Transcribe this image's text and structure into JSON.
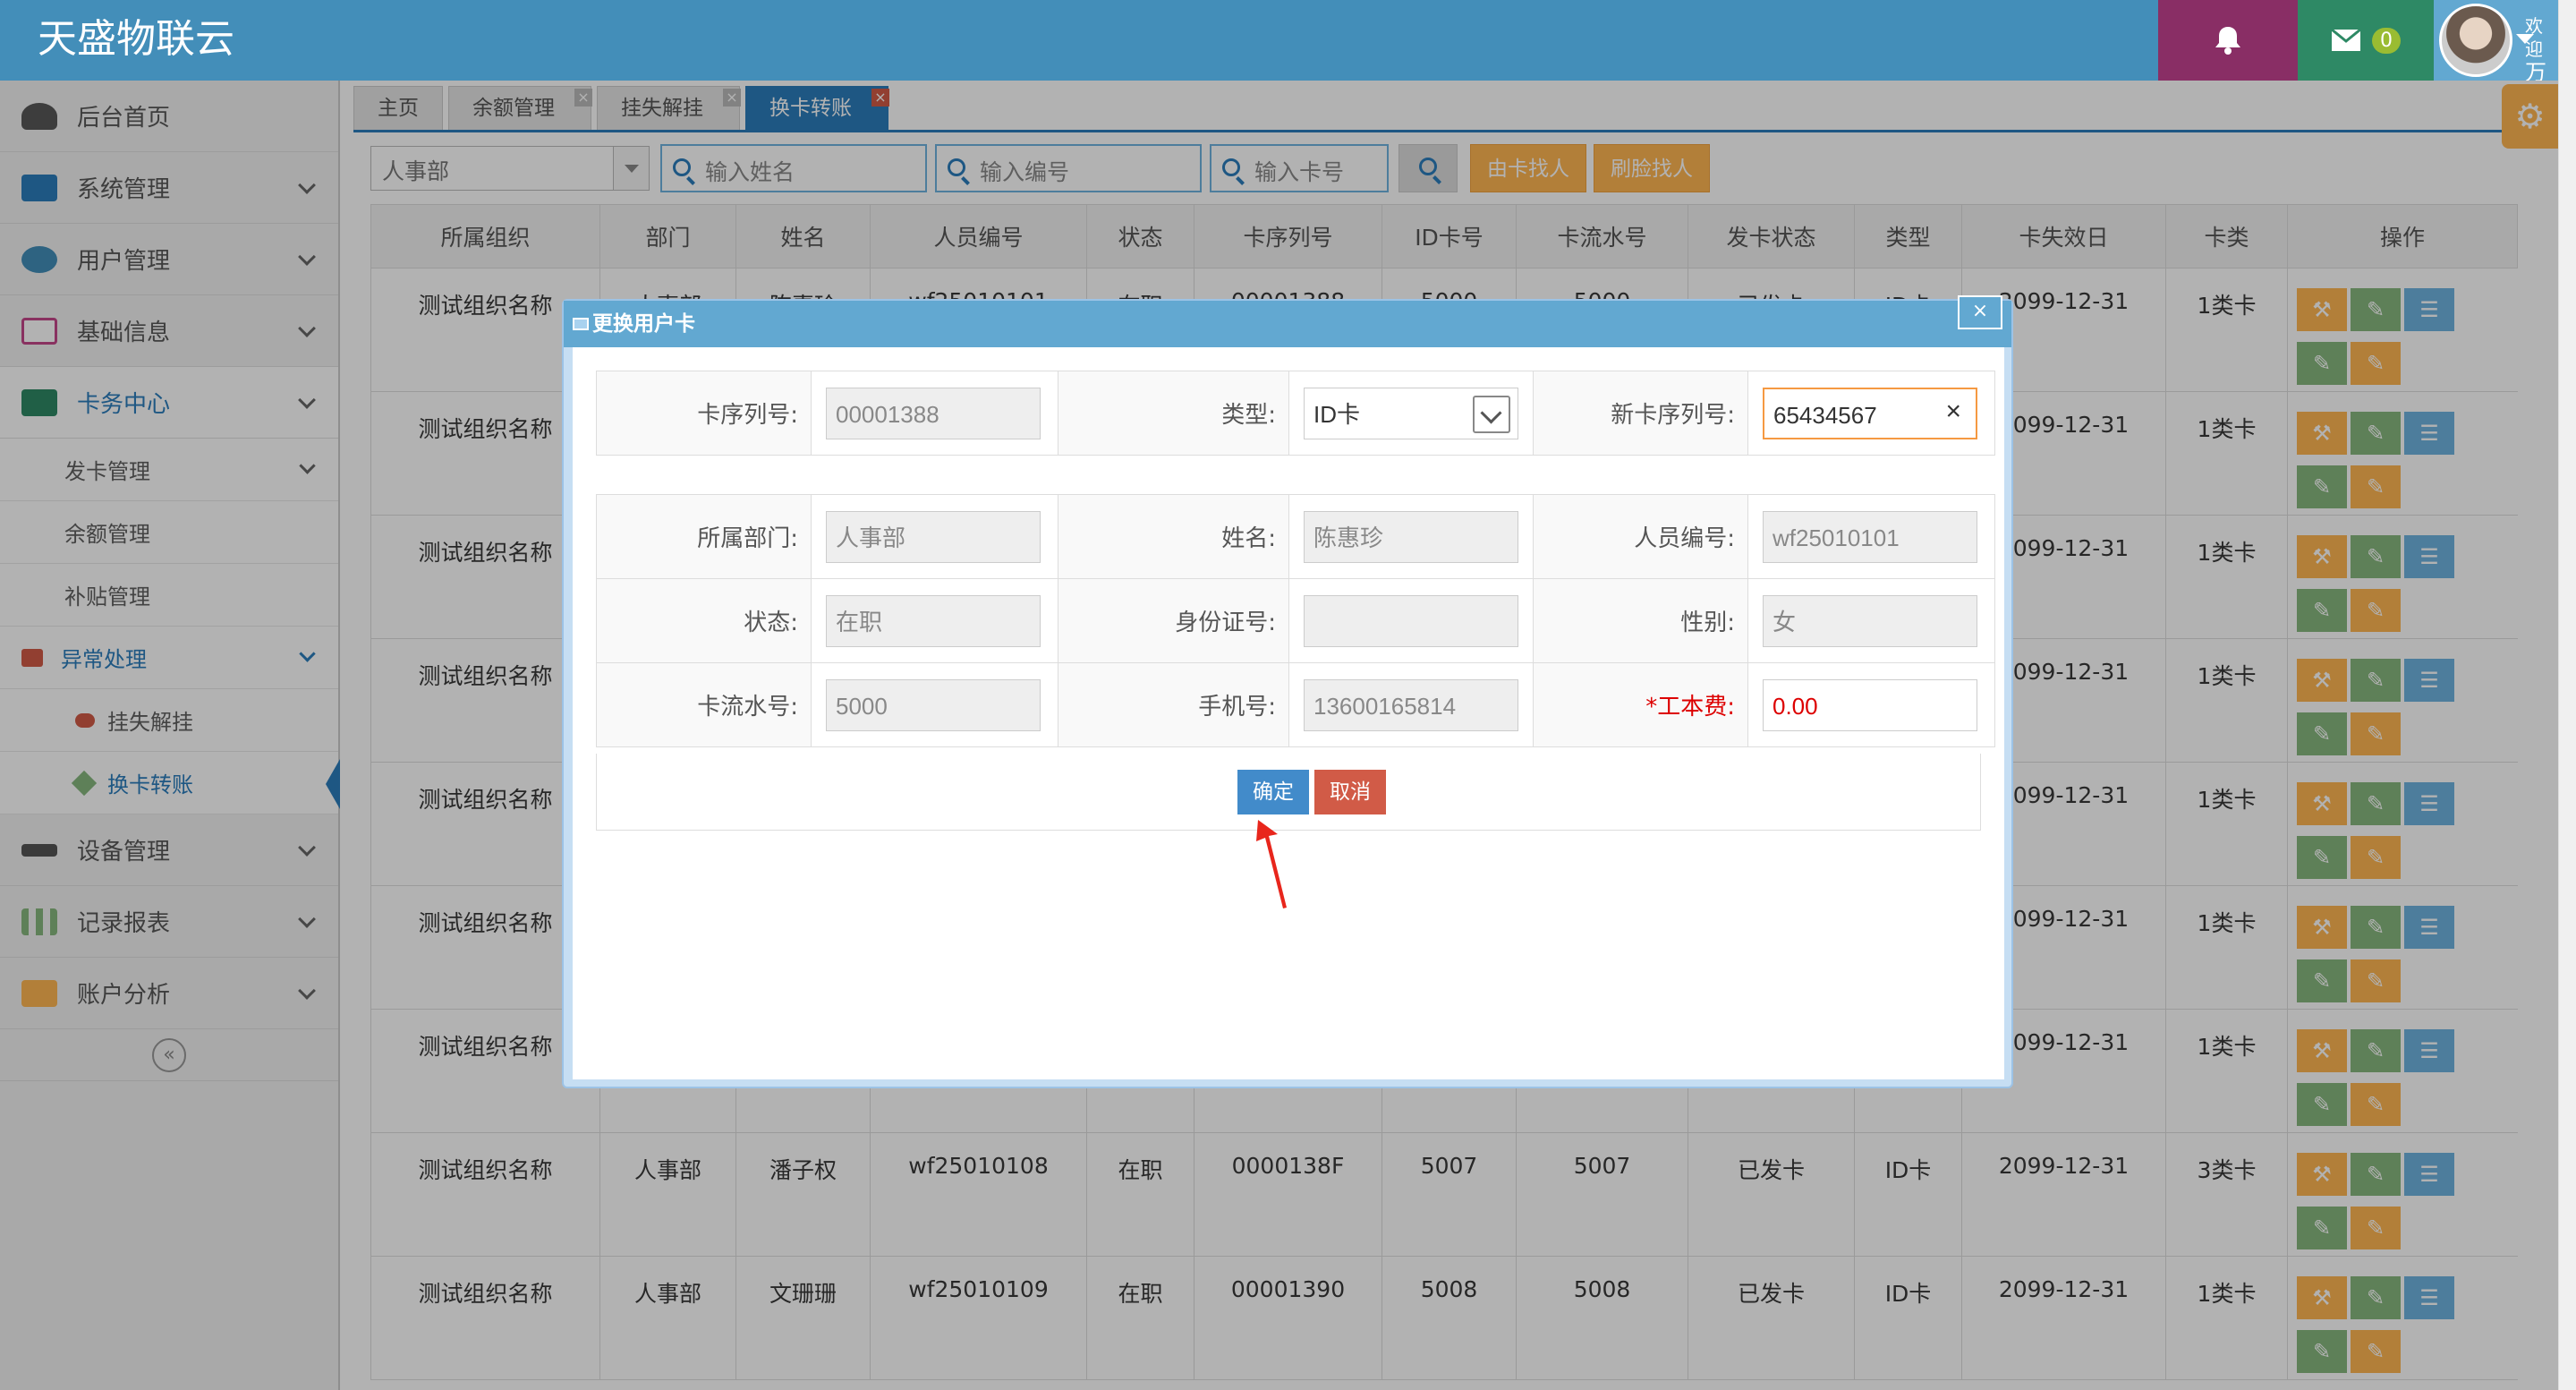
{
  "app": {
    "title": "天盛物联云"
  },
  "header": {
    "mail_count": "0",
    "welcome": "欢迎",
    "user_name": "万家"
  },
  "sidebar": {
    "items": [
      {
        "label": "后台首页",
        "icon": "dashboard-icon",
        "color": "#585858"
      },
      {
        "label": "系统管理",
        "icon": "desktop-icon",
        "color": "#2b7dbc"
      },
      {
        "label": "用户管理",
        "icon": "users-icon",
        "color": "#438eb9"
      },
      {
        "label": "基础信息",
        "icon": "laptop-icon",
        "color": "#c4478a"
      },
      {
        "label": "卡务中心",
        "icon": "credit-card-icon",
        "color": "#2e8965"
      }
    ],
    "card_sub": [
      "发卡管理",
      "余额管理",
      "补贴管理",
      "异常处理"
    ],
    "exception_sub": [
      "挂失解挂",
      "换卡转账"
    ],
    "items_after": [
      {
        "label": "设备管理",
        "icon": "plane-icon"
      },
      {
        "label": "记录报表",
        "icon": "bar-chart-icon"
      },
      {
        "label": "账户分析",
        "icon": "calendar-icon"
      }
    ],
    "collapse": "«"
  },
  "tabs": [
    "主页",
    "余额管理",
    "挂失解挂",
    "换卡转账"
  ],
  "search": {
    "dept": "人事部",
    "name_placeholder": "输入姓名",
    "id_placeholder": "输入编号",
    "card_placeholder": "输入卡号",
    "btn_card_find": "由卡找人",
    "btn_face_find": "刷脸找人"
  },
  "table": {
    "headers": [
      "所属组织",
      "部门",
      "姓名",
      "人员编号",
      "状态",
      "卡序列号",
      "ID卡号",
      "卡流水号",
      "发卡状态",
      "类型",
      "卡失效日",
      "卡类",
      "操作"
    ],
    "rows": [
      {
        "org": "测试组织名称",
        "dept": "人事部",
        "name": "陈惠珍",
        "id": "wf25010101",
        "status": "在职",
        "serial": "00001388",
        "idcard": "5000",
        "flow": "5000",
        "issue": "已发卡",
        "type": "ID卡",
        "expire": "2099-12-31",
        "cls": "1类卡"
      },
      {
        "org": "测试组织名称",
        "expire": "2099-12-31",
        "cls": "1类卡"
      },
      {
        "org": "测试组织名称",
        "expire": "2099-12-31",
        "cls": "1类卡"
      },
      {
        "org": "测试组织名称",
        "expire": "2099-12-31",
        "cls": "1类卡"
      },
      {
        "org": "测试组织名称",
        "expire": "2099-12-31",
        "cls": "1类卡"
      },
      {
        "org": "测试组织名称",
        "expire": "2099-12-31",
        "cls": "1类卡"
      },
      {
        "org": "测试组织名称",
        "expire": "2099-12-31",
        "cls": "1类卡"
      },
      {
        "org": "测试组织名称",
        "dept": "人事部",
        "name": "潘子权",
        "id": "wf25010108",
        "status": "在职",
        "serial": "0000138F",
        "idcard": "5007",
        "flow": "5007",
        "issue": "已发卡",
        "type": "ID卡",
        "expire": "2099-12-31",
        "cls": "3类卡"
      },
      {
        "org": "测试组织名称",
        "dept": "人事部",
        "name": "文珊珊",
        "id": "wf25010109",
        "status": "在职",
        "serial": "00001390",
        "idcard": "5008",
        "flow": "5008",
        "issue": "已发卡",
        "type": "ID卡",
        "expire": "2099-12-31",
        "cls": "1类卡"
      }
    ]
  },
  "dialog": {
    "title": "更换用户卡",
    "close": "×",
    "serial_label": "卡序列号:",
    "serial_value": "00001388",
    "type_label": "类型:",
    "type_value": "ID卡",
    "new_serial_label": "新卡序列号:",
    "new_serial_value": "65434567",
    "dept_label": "所属部门:",
    "dept_value": "人事部",
    "name_label": "姓名:",
    "name_value": "陈惠珍",
    "pid_label": "人员编号:",
    "pid_value": "wf25010101",
    "status_label": "状态:",
    "status_value": "在职",
    "idno_label": "身份证号:",
    "idno_value": "",
    "gender_label": "性别:",
    "gender_value": "女",
    "flow_label": "卡流水号:",
    "flow_value": "5000",
    "phone_label": "手机号:",
    "phone_value": "13600165814",
    "fee_label": "*工本费:",
    "fee_value": "0.00",
    "ok": "确定",
    "cancel": "取消"
  },
  "colors": {
    "navbar": "#438eb9",
    "accent": "#2b7dbc",
    "warning": "#ffb752",
    "danger": "#d15b47",
    "success": "#87b87f"
  }
}
